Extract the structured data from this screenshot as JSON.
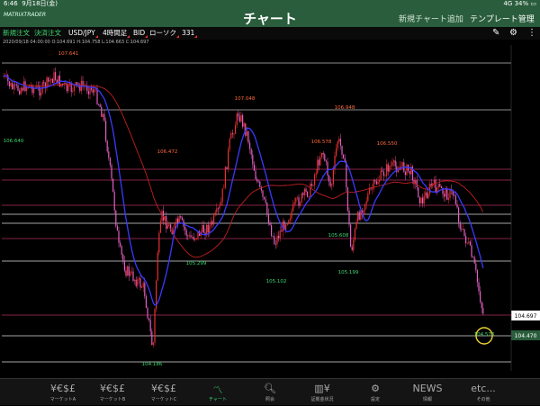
{
  "status": {
    "time": "6:46",
    "date": "9月18日(金)",
    "signal": "4G",
    "battery": "34%"
  },
  "header": {
    "logo": "MATRIXTRADER",
    "title": "チャート",
    "add_chart": "新規チャート追加",
    "template": "テンプレート管理"
  },
  "toolbar": {
    "new_order": "新規注文",
    "settle_order": "決済注文",
    "pair": "USD/JPY",
    "timeframe": "4時間足",
    "price_type": "BID",
    "chart_type": "ローソク",
    "count": "331"
  },
  "ohlc": "2020/09/18 04:00:00   O:104.691  H:104.758  L:104.663  C:104.697",
  "right_labels": {
    "current": "104.697",
    "line": "104.470"
  },
  "price_annotations": [
    {
      "text": "107.641",
      "color": "#ff6a3a"
    },
    {
      "text": "106.640",
      "color": "#3fd870"
    },
    {
      "text": "106.472",
      "color": "#ff6a3a"
    },
    {
      "text": "107.048",
      "color": "#ff6a3a"
    },
    {
      "text": "105.299",
      "color": "#3fd870"
    },
    {
      "text": "105.102",
      "color": "#3fd870"
    },
    {
      "text": "106.578",
      "color": "#ff6a3a"
    },
    {
      "text": "106.948",
      "color": "#ff6a3a"
    },
    {
      "text": "105.608",
      "color": "#3fd870"
    },
    {
      "text": "105.199",
      "color": "#3fd870"
    },
    {
      "text": "106.550",
      "color": "#ff6a3a"
    },
    {
      "text": "104.186",
      "color": "#3fd870"
    },
    {
      "text": "104.573",
      "color": "#3fd870"
    }
  ],
  "tabs": [
    {
      "label": "マーケットA",
      "icon": "¥€$£"
    },
    {
      "label": "マーケットB",
      "icon": "¥€$£"
    },
    {
      "label": "マーケットC",
      "icon": "¥€$£"
    },
    {
      "label": "チャート",
      "icon": "chart-icon"
    },
    {
      "label": "照会",
      "icon": "search-icon"
    },
    {
      "label": "証拠金状況",
      "icon": "margin-icon"
    },
    {
      "label": "設定",
      "icon": "gear-icon"
    },
    {
      "label": "情報",
      "icon": "NEWS"
    },
    {
      "label": "その他",
      "icon": "etc..."
    }
  ],
  "colors": {
    "header": "#2a5d3c",
    "bull": "#e83030",
    "bear": "#e060c0",
    "ma_short": "#3a3aff",
    "ma_long": "#c02020",
    "active": "#3fd870"
  }
}
